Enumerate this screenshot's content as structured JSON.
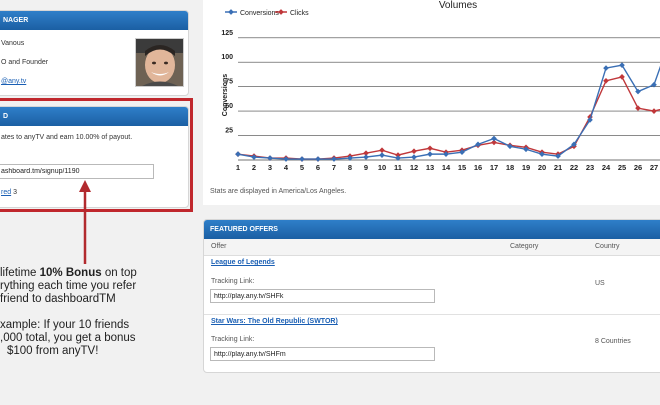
{
  "manager": {
    "header": "NAGER",
    "name": "Vanous",
    "role": "O and Founder",
    "email": "@any.tv"
  },
  "referral": {
    "header": "D",
    "description": "ates to anyTV and earn 10.00% of payout.",
    "link_value": "ashboard.tm/signup/1190",
    "referred_link": "red",
    "referred_count": "3"
  },
  "callout": {
    "line1_pre": "lifetime ",
    "line1_bold": "10% Bonus",
    "line1_post": " on top",
    "line2": "rything each time you refer",
    "line3": "friend to dashboardTM",
    "line4": "xample: If your 10 friends",
    "line5": ",000 total, you get a bonus",
    "line6": "$100 from anyTV!"
  },
  "colors": {
    "accent": "#1b5fa3",
    "highlight_box": "#c0272d",
    "conversions": "#3a6fb5",
    "clicks": "#c0373a"
  },
  "chart_data": {
    "type": "line",
    "title": "Volumes",
    "ylabel": "Conversions",
    "ylim": [
      0,
      135
    ],
    "yticks": [
      25,
      50,
      75,
      100,
      125
    ],
    "x": [
      "1",
      "2",
      "3",
      "4",
      "5",
      "6",
      "7",
      "8",
      "9",
      "10",
      "11",
      "12",
      "13",
      "14",
      "15",
      "16",
      "17",
      "18",
      "19",
      "20",
      "21",
      "22",
      "23",
      "24",
      "25",
      "26",
      "27"
    ],
    "series": [
      {
        "name": "Conversions",
        "color": "#3a6fb5",
        "values": [
          6,
          3,
          2,
          1,
          1,
          1,
          1,
          2,
          3,
          5,
          2,
          3,
          6,
          6,
          8,
          16,
          22,
          14,
          11,
          6,
          4,
          16,
          41,
          94,
          97,
          70,
          77,
          123
        ]
      },
      {
        "name": "Clicks",
        "color": "#c0373a",
        "values": [
          6,
          4,
          2,
          2,
          1,
          1,
          2,
          4,
          7,
          10,
          5,
          9,
          12,
          8,
          10,
          15,
          18,
          15,
          13,
          8,
          6,
          14,
          44,
          81,
          85,
          53,
          50,
          54
        ]
      }
    ],
    "legend_position": "top-left",
    "footnote": "Stats are displayed in America/Los Angeles."
  },
  "offers": {
    "header": "FEATURED OFFERS",
    "columns": [
      "Offer",
      "Category",
      "Country"
    ],
    "rows": [
      {
        "name": "League of Legends",
        "tracking_label": "Tracking Link:",
        "tracking_url": "http://play.any.tv/SHFk",
        "category": "",
        "country": "US"
      },
      {
        "name": "Star Wars: The Old Republic (SWTOR)",
        "tracking_label": "Tracking Link:",
        "tracking_url": "http://play.any.tv/SHFm",
        "category": "",
        "country": "8 Countries"
      }
    ]
  }
}
